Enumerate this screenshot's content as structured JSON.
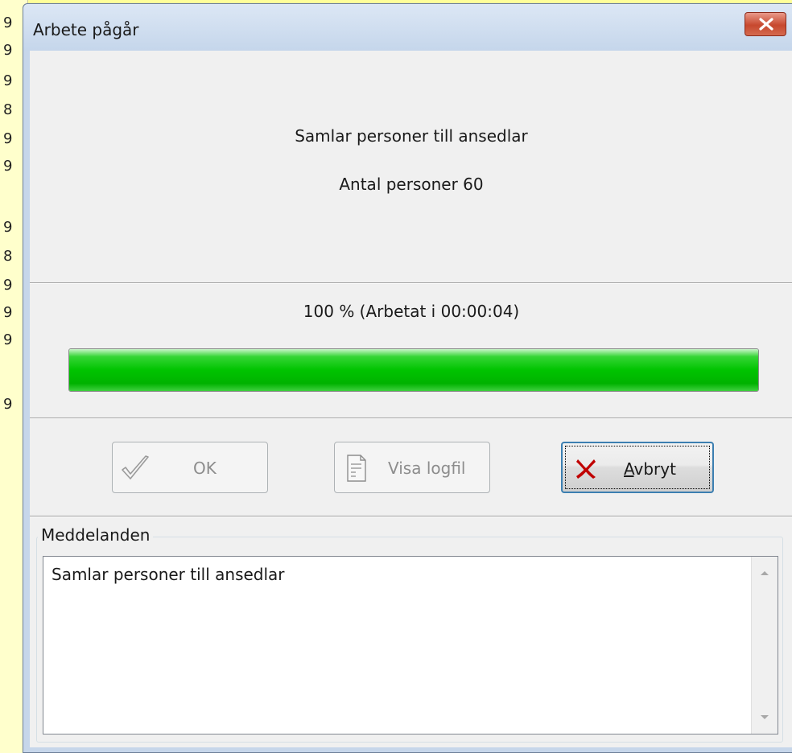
{
  "dialog": {
    "title": "Arbete pågår"
  },
  "status": {
    "line1": "Samlar personer till ansedlar",
    "line2": "Antal personer 60"
  },
  "progress": {
    "text": "100 % (Arbetat i 00:00:04)",
    "percent": 100
  },
  "buttons": {
    "ok": "OK",
    "view_log": "Visa logfil",
    "cancel_prefix": "A",
    "cancel_rest": "vbryt"
  },
  "messages": {
    "group_label": "Meddelanden",
    "text": "Samlar personer till ansedlar"
  },
  "background": {
    "chars": [
      "9",
      "9",
      "9",
      "8",
      "9",
      "9",
      "9",
      "8",
      "9",
      "9",
      "9",
      "9"
    ]
  },
  "colors": {
    "progress_fill": "#00c400",
    "cancel_icon": "#c00000",
    "close_button": "#c7482e"
  }
}
